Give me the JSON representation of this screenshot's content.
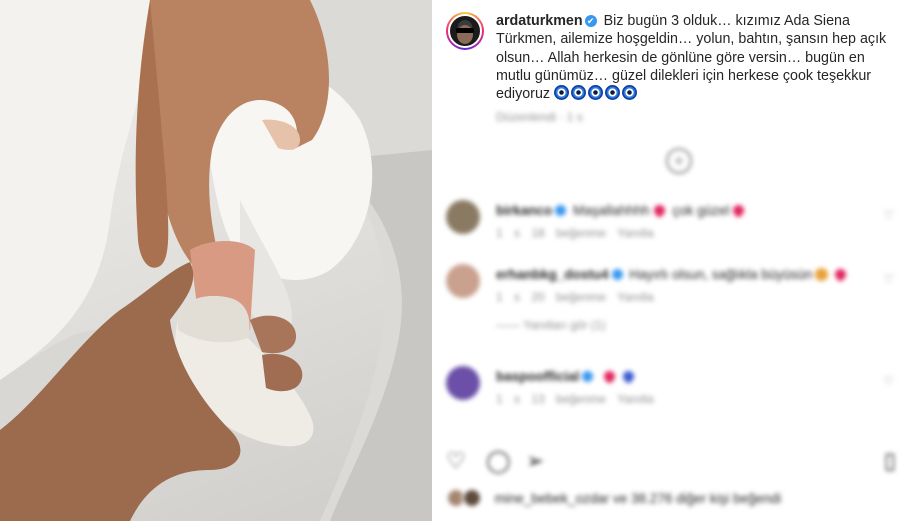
{
  "post": {
    "username": "ardaturkmen",
    "verified_mark": "✔",
    "caption": "Biz bugün 3 olduk… kızımız Ada Siena Türkmen, ailemize hoşgeldin… yolun, bahtın, şansın hep açık olsun… Allah herkesin de gönlüne göre versin… bugün en mutlu günümüz… güzel dilekleri için herkese çook teşekkur ediyoruz",
    "caption_emoji_count": 5,
    "time_ago": "Düzenlendi · 1 s"
  },
  "comments": [
    {
      "username": "birkanco",
      "text": "Maşallahhhh",
      "text_after": "çok güzel",
      "meta": "1 s  18 beğenme  Yanıtla",
      "avatar_color": "#8a7a63"
    },
    {
      "username": "erhanbkg_dostu4",
      "text": "Hayırlı olsun, sağlıkla büyüsün",
      "text_after": "",
      "meta": "1 s  20 beğenme  Yanıtla",
      "replies": "——  Yanıtları gör (1)",
      "avatar_color": "#c9a18e"
    },
    {
      "username": "baspoofficial",
      "text": "",
      "text_after": "",
      "meta": "1 s  13 beğenme  Yanıtla",
      "avatar_color": "#6b4fa8"
    }
  ],
  "actions": {
    "like_icon": "heart-outline-icon",
    "comment_icon": "comment-icon",
    "share_icon": "paper-plane-icon",
    "save_icon": "bookmark-icon"
  },
  "likes": {
    "text": "mine_bebek_ozdar ve 38.276 diğer kişi beğendi"
  },
  "colors": {
    "verified": "#3897f0",
    "heart": "#e0245e",
    "muted": "#8e8e8e"
  }
}
